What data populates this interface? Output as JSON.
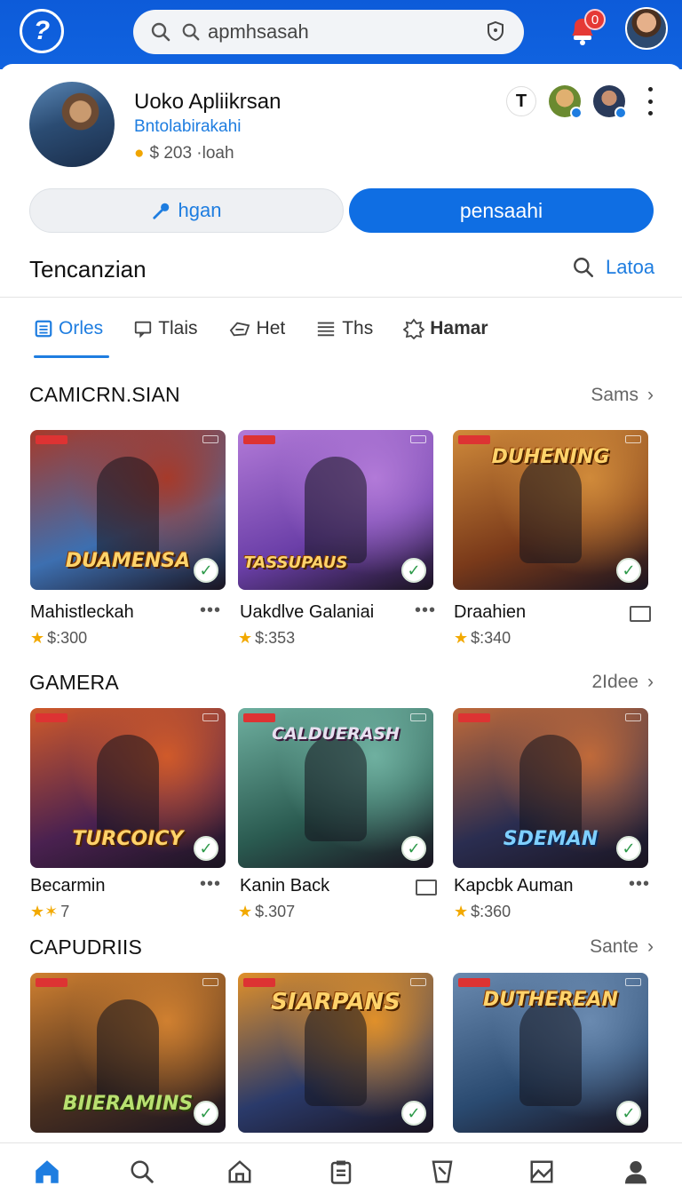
{
  "search": {
    "query": "apmhsasah"
  },
  "notifications": {
    "count": "0"
  },
  "profile": {
    "name": "Uoko Apliikrsan",
    "handle": "Bntolabirakahi",
    "coins": "$ 203 ·loah",
    "chip_letter": "T"
  },
  "actions": {
    "secondary_label": "hgan",
    "primary_label": "pensaahi"
  },
  "section": {
    "title": "Tencanzian",
    "find_label": "Latoa"
  },
  "tabs": [
    {
      "label": "Orles",
      "icon": "list-icon",
      "active": true
    },
    {
      "label": "Tlais",
      "icon": "chat-icon",
      "active": false
    },
    {
      "label": "Het",
      "icon": "tag-icon",
      "active": false
    },
    {
      "label": "Ths",
      "icon": "lines-icon",
      "active": false
    },
    {
      "label": "Hamar",
      "icon": "badge-icon",
      "active": false
    }
  ],
  "categories": [
    {
      "title": "CAMICRN.SIAN",
      "more": "Sams",
      "games": [
        {
          "name": "Mahistleckah",
          "price": "$:300",
          "logo": "DUAMENSA",
          "colors": [
            "#3d6fb0",
            "#a63a2a"
          ]
        },
        {
          "name": "Uakdlve Galaniai",
          "price": "$:353",
          "logo": "TASSUPAUS",
          "colors": [
            "#6b3fa8",
            "#b27ad8"
          ]
        },
        {
          "name": "Draahien",
          "price": "$:340",
          "logo": "DUHENING",
          "colors": [
            "#7a3a1a",
            "#d08a3a"
          ]
        }
      ]
    },
    {
      "title": "GAMERA",
      "more": "2Idee",
      "games": [
        {
          "name": "Becarmin",
          "price": "7",
          "logo": "TURCOICY",
          "colors": [
            "#4a2150",
            "#d05a2a"
          ]
        },
        {
          "name": "Kanin Back",
          "price": "$.307",
          "logo": "CALDUERASH",
          "colors": [
            "#2a5a50",
            "#6fb0a0"
          ]
        },
        {
          "name": "Kapcbk Auman",
          "price": "$:360",
          "logo": "SDEMAN",
          "colors": [
            "#2a2d50",
            "#c06a3a"
          ]
        }
      ]
    },
    {
      "title": "CAPUDRIIS",
      "more": "Sante",
      "games": [
        {
          "name": "",
          "price": "",
          "logo": "BIIERAMINS",
          "colors": [
            "#4a3020",
            "#d08030"
          ]
        },
        {
          "name": "",
          "price": "",
          "logo": "SIARPANS",
          "colors": [
            "#2a3a6a",
            "#e0902a"
          ]
        },
        {
          "name": "",
          "price": "",
          "logo": "DUTHEREAN",
          "colors": [
            "#2a4a70",
            "#6a8ab0"
          ]
        }
      ]
    }
  ],
  "nav": [
    "home-icon",
    "search-icon",
    "store-icon",
    "clipboard-icon",
    "cup-icon",
    "image-icon",
    "profile-icon"
  ]
}
